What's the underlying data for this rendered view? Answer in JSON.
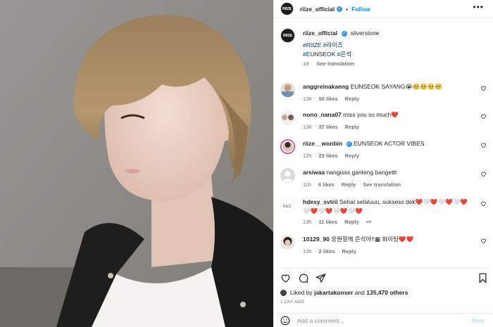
{
  "header": {
    "username": "riize_official",
    "separator": "•",
    "follow_label": "Follow",
    "more_label": "•••",
    "avatar_text": "RIIZE"
  },
  "post": {
    "username": "riize_official",
    "location": "silverstone",
    "tags_line1": "#RIIZE #라이즈",
    "tags_line2": "#EUNSEOK #은석",
    "age": "1d",
    "see_translation": "See translation"
  },
  "comments": [
    {
      "user": "anggreinakaeng",
      "text": "EUNSEOK SAYANG😭🥺🥺🥺🥺",
      "age": "13h",
      "likes": "50 likes",
      "reply": "Reply",
      "translation": ""
    },
    {
      "user": "nono_nana07",
      "text": "miss you so much❤️",
      "age": "13h",
      "likes": "37 likes",
      "reply": "Reply",
      "translation": ""
    },
    {
      "user": "riize__wonbin",
      "text": "EUNSEOK ACTOR VIBES",
      "age": "12h",
      "likes": "23 likes",
      "reply": "Reply",
      "translation": ""
    },
    {
      "user": "arsiwaa",
      "text": "nangisss ganteng bangettt",
      "age": "11h",
      "likes": "6 likes",
      "reply": "Reply",
      "translation": "See translation"
    },
    {
      "user": "hdesy_svtrii",
      "text": "Sehat selaluuu, suksess dek❤️🤍❤️🤍❤️🤍❤️",
      "text2": "🤍❤️🤍❤️🤍❤️🤍❤️",
      "age": "13h",
      "likes": "11 likes",
      "reply": "Reply",
      "translation": "•••"
    },
    {
      "user": "10129_90",
      "text": "응원할께 은석아!!▦ 화이팅❤️❤️",
      "age": "13h",
      "likes": "2 likes",
      "reply": "Reply",
      "translation": ""
    }
  ],
  "liked_by": {
    "prefix": "Liked by",
    "user": "jakartakonser",
    "and": "and",
    "others": "135,470 others"
  },
  "date": "1 DAY AGO",
  "add_comment": {
    "placeholder": "Add a comment...",
    "post_label": "Post"
  },
  "colors": {
    "link_blue": "#0095f6",
    "hashtag": "#00376b",
    "muted": "#737373",
    "heart": "#ed4956"
  }
}
